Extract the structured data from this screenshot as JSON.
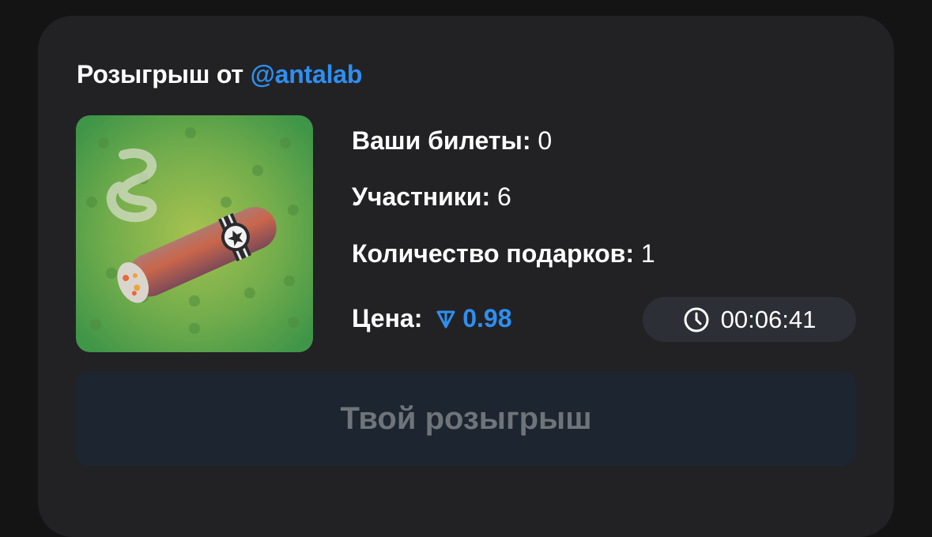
{
  "giveaway": {
    "title_prefix": "Розыгрыш от",
    "organizer": "@antalab"
  },
  "gift": {
    "icon": "cigar-gift-icon",
    "background_color": "#4e9a45"
  },
  "stats": {
    "tickets_label": "Ваши билеты:",
    "tickets_value": "0",
    "participants_label": "Участники:",
    "participants_value": "6",
    "gifts_label": "Количество подарков:",
    "gifts_value": "1",
    "price_label": "Цена:",
    "price_currency_icon": "ton-icon",
    "price_value": "0.98"
  },
  "timer": {
    "icon": "clock-icon",
    "value": "00:06:41"
  },
  "action": {
    "label": "Твой розыгрыш"
  },
  "colors": {
    "accent": "#2e8ff0",
    "card_background": "#222224",
    "page_background": "#141415",
    "button_background": "#1d2530",
    "button_text": "#6f7479"
  }
}
